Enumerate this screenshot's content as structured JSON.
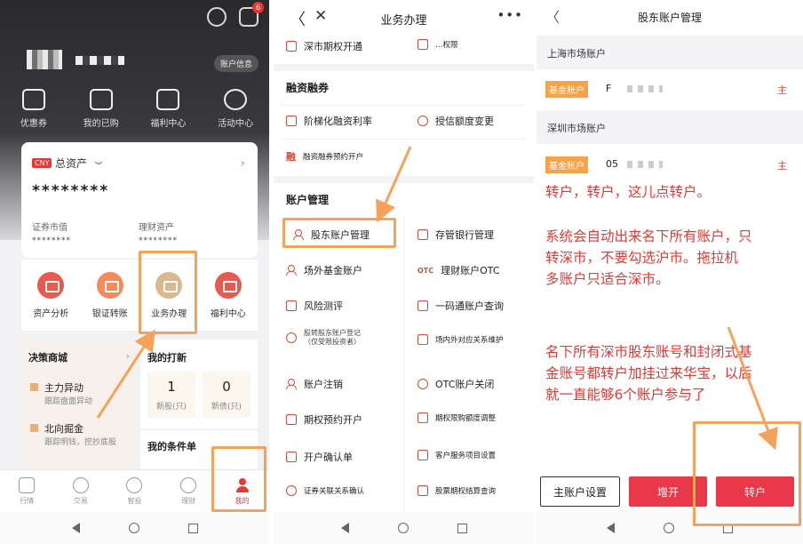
{
  "panel1": {
    "notification_count": "6",
    "account_info_label": "账户信息",
    "quick": [
      {
        "label": "优惠券",
        "icon": "coupon-icon"
      },
      {
        "label": "我的已购",
        "icon": "purchased-icon"
      },
      {
        "label": "福利中心",
        "icon": "gift-icon"
      },
      {
        "label": "活动中心",
        "icon": "planet-icon"
      }
    ],
    "asset": {
      "currency_tag": "CNY",
      "title": "总资产",
      "value_masked": "********",
      "sec_label": "证券市值",
      "sec_value": "********",
      "wealth_label": "理财资产",
      "wealth_value": "********"
    },
    "functions": [
      {
        "label": "资产分析"
      },
      {
        "label": "银证转账"
      },
      {
        "label": "业务办理"
      },
      {
        "label": "福利中心"
      }
    ],
    "decision": {
      "title": "决策商城",
      "items": [
        {
          "title": "主力异动",
          "desc": "跟踪盘面异动"
        },
        {
          "title": "北向掘金",
          "desc": "跟踪明钱，挖抄底股"
        }
      ]
    },
    "ipo": {
      "title": "我的打新",
      "stock_count": "1",
      "stock_unit": "新股(只)",
      "bond_count": "0",
      "bond_unit": "新债(只)"
    },
    "conditions_title": "我的条件单",
    "tabs": [
      {
        "label": "行情"
      },
      {
        "label": "交易"
      },
      {
        "label": "智投"
      },
      {
        "label": "理财"
      },
      {
        "label": "我的"
      }
    ]
  },
  "panel2": {
    "title": "业务办理",
    "more": "•••",
    "top_left": "深市期权开通",
    "top_right": "…权限",
    "margin_section": "融资融券",
    "margin_items": [
      {
        "label": "阶梯化融资利率"
      },
      {
        "label": "授信额度变更"
      },
      {
        "label": "融资融券预约开户"
      }
    ],
    "account_section": "账户管理",
    "rows": [
      [
        "股东账户管理",
        "存管银行管理"
      ],
      [
        "场外基金账户",
        "理财账户OTC"
      ],
      [
        "风险测评",
        "一码通账户查询"
      ],
      [
        "股转股东账户登记",
        "场内外对应关系维护"
      ],
      [
        "账户注销",
        "OTC账户关闭"
      ],
      [
        "期权预约开户",
        "期权限购额度调整"
      ],
      [
        "开户确认单",
        "客户服务项目设置"
      ],
      [
        "证券关联关系确认",
        "股票期权结算查询"
      ]
    ],
    "rows_sub": "（仅受限投资者）"
  },
  "panel3": {
    "title": "股东账户管理",
    "sh_label": "上海市场账户",
    "sz_label": "深圳市场账户",
    "fund_tag": "基金账户",
    "sh_acct_prefix": "F",
    "sz_acct_prefix": "05",
    "main_tag": "主",
    "note1": "转户，转户，这儿点转户。",
    "note2": "系统会自动出来名下所有账户，只\n转深市，不要勾选沪市。拖拉机\n多账户只适合深市。",
    "note3": "名下所有深市股东账号和封闭式基\n金账号都转户加挂过来华宝，以后\n就一直能够6个账户参与了",
    "btn_main": "主账户设置",
    "btn_add": "增开",
    "btn_transfer": "转户"
  },
  "colors": {
    "accent_red": "#e53935",
    "highlight_orange": "#f5a35a",
    "fund_tag_orange": "#f6a34a",
    "button_red": "#e8384a"
  }
}
